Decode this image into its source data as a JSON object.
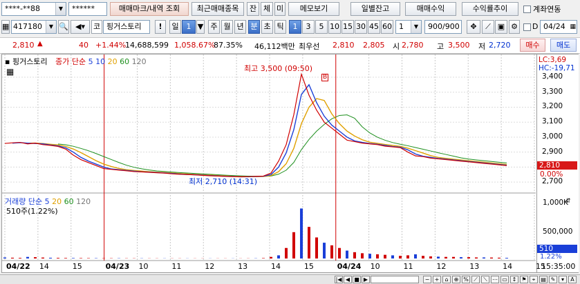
{
  "toolbar1": {
    "account": "****-**88",
    "password": "******",
    "trade_mark_btn": "매매마크/내역 조회",
    "recent_btn": "최근매매종목",
    "jan_btn": "잔",
    "che_btn": "체",
    "mi_btn": "미",
    "memo_btn": "메모보기",
    "daily_balance_btn": "일별잔고",
    "trade_profit_btn": "매매수익",
    "profit_trend_btn": "수익률추이",
    "account_link_label": "계좌연동"
  },
  "toolbar2": {
    "code": "417180",
    "market": "코",
    "stock_name": "핑거스토리",
    "bang_btn": "!",
    "period_il": "일",
    "period_value": "1",
    "period_ju": "주",
    "period_wol": "월",
    "period_nyeon": "년",
    "period_bun": "분",
    "period_cho": "초",
    "period_tik": "틱",
    "intervals": [
      "1",
      "3",
      "5",
      "10",
      "15",
      "30",
      "45",
      "60"
    ],
    "interval_select": "1",
    "count": "900",
    "count_total": "/900",
    "date_checkbox_label": "D",
    "date": "04/24"
  },
  "quote": {
    "price": "2,810",
    "arrow": "▲",
    "change": "40",
    "change_pct": "+1.44%",
    "volume": "14,688,599",
    "volume_ratio": "1,058.67%",
    "rate2": "87.35%",
    "amount": "46,112백만",
    "best_label": "최우선",
    "best_ask": "2,810",
    "best_bid": "2,805",
    "open_label": "시",
    "open": "2,780",
    "high_label": "고",
    "high": "3,500",
    "low_label": "저",
    "low": "2,720",
    "buy_btn": "매수",
    "sell_btn": "매도"
  },
  "chart_data": [
    {
      "type": "line",
      "title": "핑거스토리",
      "legend": [
        "종가",
        "단순",
        "5",
        "10",
        "20",
        "60",
        "120"
      ],
      "annotations": {
        "high": "최고 3,500 (09:50)",
        "low": "최저 2,710 (14:31)",
        "marker": "B"
      },
      "lc": "LC:3,69",
      "hc": "HC:-19,71",
      "y_ticks": [
        "3,400",
        "3,300",
        "3,200",
        "3,100",
        "3,000",
        "2,900",
        "2,800",
        "2,700"
      ],
      "ylim": [
        2650,
        3460
      ],
      "current_label": "2,810",
      "current_pct": "0.00%",
      "x_ticks": [
        "04/22",
        "14",
        "15",
        "04/23",
        "10",
        "11",
        "12",
        "13",
        "14",
        "15",
        "04/24",
        "10",
        "11",
        "12",
        "13",
        "14",
        "15"
      ],
      "series": [
        {
          "name": "종가",
          "color": "#d00000",
          "values": [
            2958,
            2962,
            2965,
            2955,
            2960,
            2950,
            2945,
            2938,
            2920,
            2880,
            2850,
            2830,
            2810,
            2790,
            2785,
            2780,
            2775,
            2770,
            2768,
            2765,
            2762,
            2760,
            2755,
            2752,
            2750,
            2748,
            2745,
            2742,
            2740,
            2738,
            2736,
            2735,
            2736,
            2738,
            2740,
            2760,
            2840,
            2950,
            3150,
            3420,
            3280,
            3180,
            3100,
            3060,
            3020,
            2980,
            2970,
            2960,
            2955,
            2950,
            2940,
            2935,
            2930,
            2900,
            2875,
            2870,
            2860,
            2855,
            2850,
            2845,
            2840,
            2835,
            2830,
            2825,
            2820,
            2815,
            2810
          ]
        }
      ]
    },
    {
      "type": "bar",
      "title": "거래량",
      "legend": [
        "거래량",
        "단순",
        "5",
        "20",
        "60",
        "120"
      ],
      "current": "510주(1.22%)",
      "y_ticks": [
        "1,000K",
        "500,000"
      ],
      "last_value": "510",
      "last_pct": "1.22%",
      "ylim": [
        0,
        1100000
      ],
      "values": [
        20000,
        15000,
        12000,
        30000,
        25000,
        18000,
        14000,
        12000,
        10000,
        9000,
        8000,
        7000,
        6000,
        6000,
        5000,
        5000,
        4000,
        4000,
        4000,
        3000,
        3000,
        3000,
        3000,
        3000,
        2500,
        2500,
        2500,
        2500,
        2500,
        2500,
        2500,
        2500,
        3000,
        4000,
        8000,
        30000,
        60000,
        200000,
        500000,
        950000,
        600000,
        400000,
        300000,
        250000,
        200000,
        150000,
        120000,
        100000,
        90000,
        80000,
        70000,
        60000,
        50000,
        60000,
        80000,
        50000,
        40000,
        35000,
        30000,
        30000,
        25000,
        25000,
        20000,
        20000,
        18000,
        15000,
        12000
      ]
    }
  ],
  "footer": {
    "time": "15:35:00"
  },
  "colors": {
    "up": "#d00000",
    "down": "#0030d0",
    "ma5": "#1a3fd8",
    "ma10": "#c3a000",
    "ma20": "#e0a000",
    "ma60": "#1d8f1d",
    "ma120": "#555555"
  }
}
